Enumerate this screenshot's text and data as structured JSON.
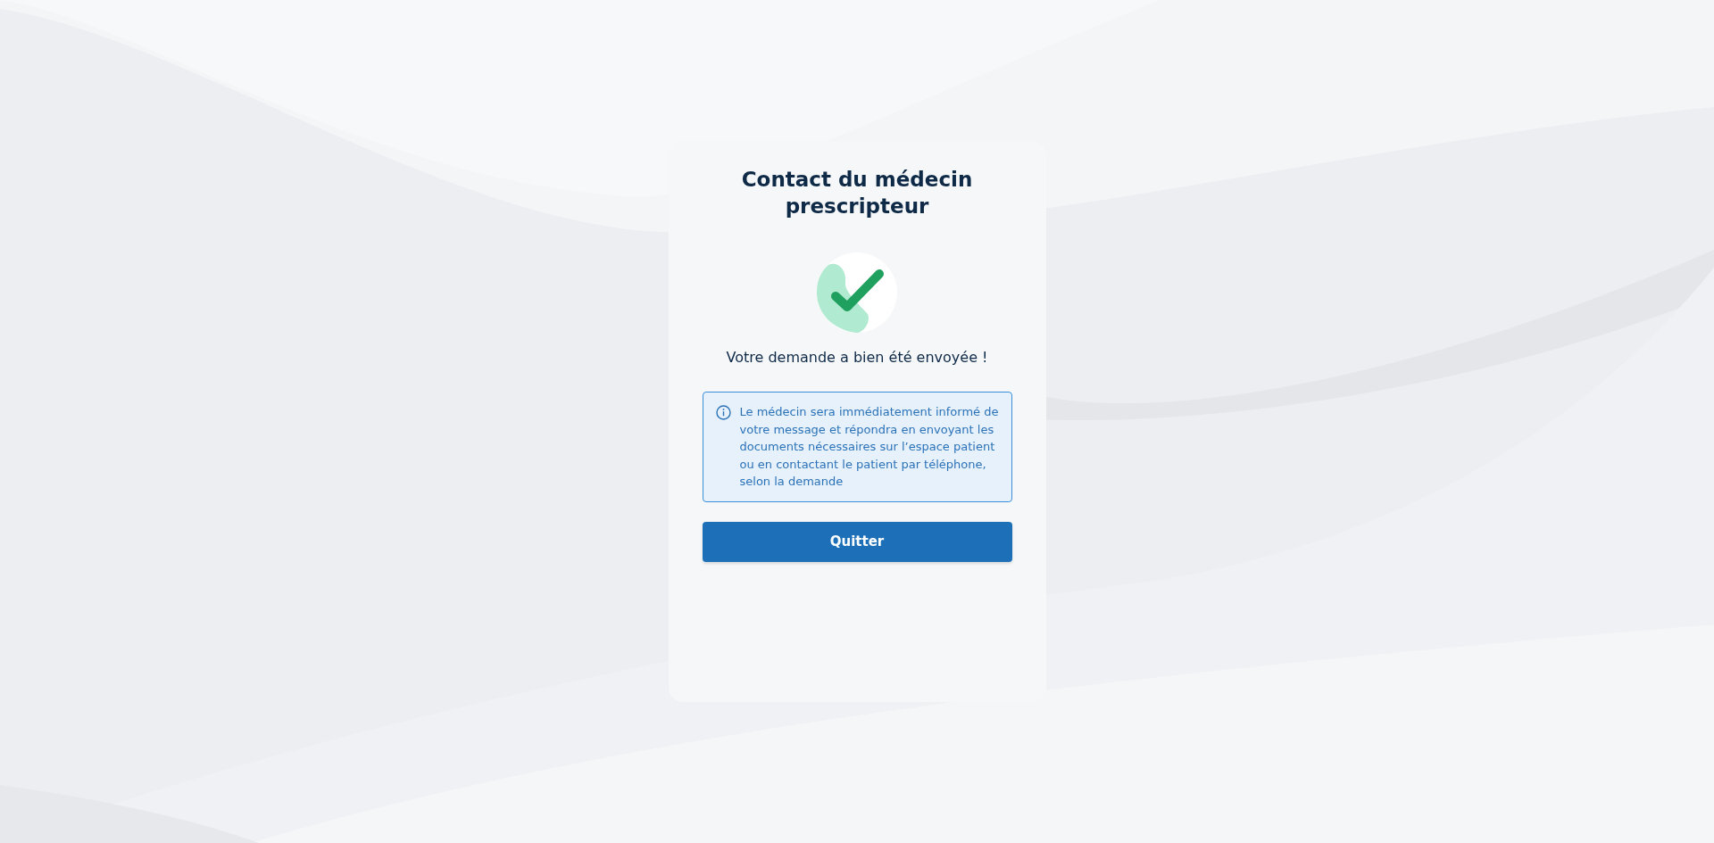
{
  "dialog": {
    "title": "Contact du médecin prescripteur",
    "message": "Votre demande a bien été envoyée !",
    "info": {
      "text": "Le médecin sera immédiatement informé de votre message et répondra en envoyant les documents nécessaires sur l’espace patient ou en contactant le patient par téléphone, selon la demande"
    },
    "buttons": [
      {
        "label": "Quitter",
        "kind": "primary"
      }
    ]
  }
}
